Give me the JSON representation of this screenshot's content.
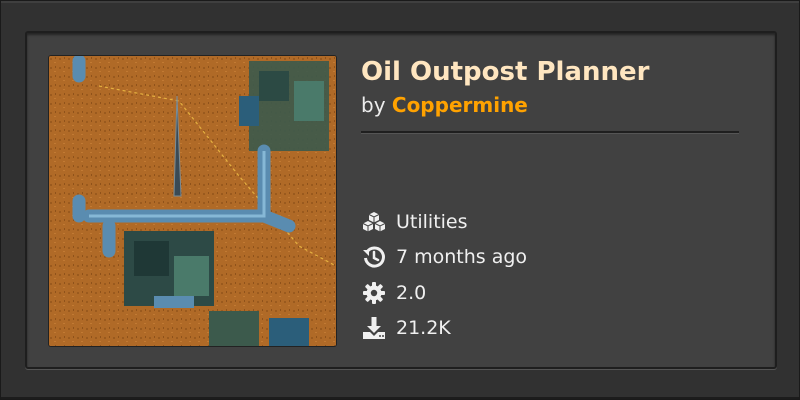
{
  "card": {
    "title": "Oil Outpost Planner",
    "by_prefix": "by",
    "author": "Coppermine",
    "thumbnail_alt": "Oil outpost blueprint preview"
  },
  "meta": {
    "category": "Utilities",
    "category_icon": "cubes-icon",
    "updated": "7 months ago",
    "updated_icon": "history-icon",
    "version": "2.0",
    "version_icon": "gear-icon",
    "downloads": "21.2K",
    "downloads_icon": "download-icon"
  },
  "colors": {
    "title": "#ffe6c0",
    "author": "#ffa200",
    "card_bg": "#414141",
    "page_bg": "#313131"
  }
}
